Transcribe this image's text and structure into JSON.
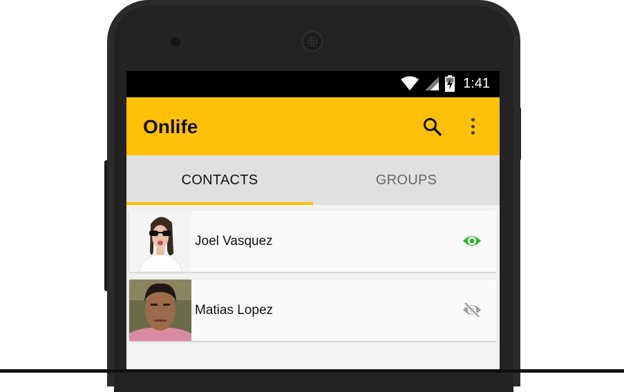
{
  "status_bar": {
    "time": "1:41"
  },
  "app_bar": {
    "title": "Onlife"
  },
  "tabs": [
    {
      "label": "CONTACTS",
      "active": true
    },
    {
      "label": "GROUPS",
      "active": false
    }
  ],
  "contacts": [
    {
      "name": "Joel Vasquez",
      "visibility": "visible",
      "visibility_icon": "eye-icon",
      "icon_color": "#2EB82E"
    },
    {
      "name": "Matias Lopez",
      "visibility": "hidden",
      "visibility_icon": "eye-off-icon",
      "icon_color": "#9E9E9E"
    }
  ],
  "colors": {
    "accent": "#FFC107",
    "tab_bar": "#E0E0E0",
    "status_bar": "#000000",
    "phone_body": "#2B2B2B"
  }
}
